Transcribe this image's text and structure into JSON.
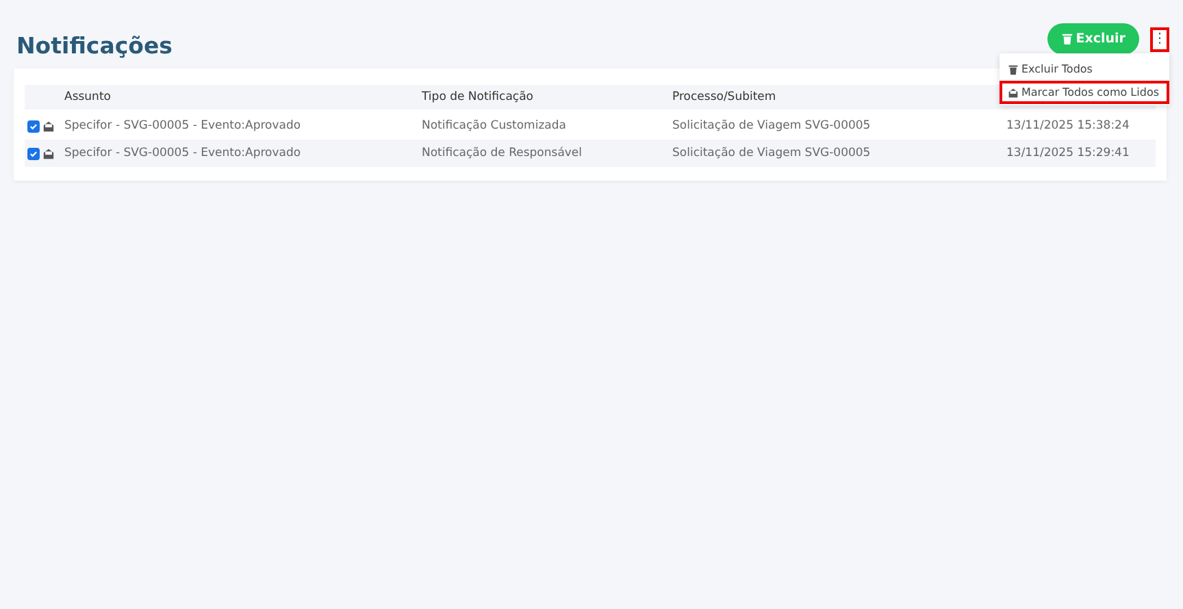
{
  "page": {
    "title": "Notificações"
  },
  "toolbar": {
    "delete_button": "Excluir",
    "more_button": {
      "label": "⋮",
      "highlighted": true
    }
  },
  "menu": {
    "items": [
      {
        "label": "Excluir Todos",
        "kind": "trash",
        "highlighted": false
      },
      {
        "label": "Marcar Todos como Lidos",
        "kind": "envelope",
        "highlighted": true
      }
    ]
  },
  "table": {
    "columns": [
      "Assunto",
      "Tipo de Notificação",
      "Processo/Subitem"
    ],
    "rows": [
      {
        "checked": true,
        "subject": "Specifor - SVG-00005 - Evento:Aprovado",
        "type": "Notificação Customizada",
        "process": "Solicitação de Viagem SVG-00005",
        "date": "13/11/2025 15:38:24"
      },
      {
        "checked": true,
        "subject": "Specifor - SVG-00005 - Evento:Aprovado",
        "type": "Notificação de Responsável",
        "process": "Solicitação de Viagem SVG-00005",
        "date": "13/11/2025 15:29:41"
      }
    ]
  }
}
